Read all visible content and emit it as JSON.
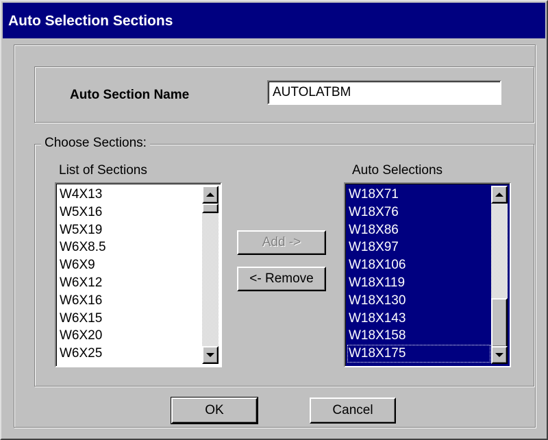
{
  "window": {
    "title": "Auto Selection Sections"
  },
  "name_field": {
    "label": "Auto Section Name",
    "value": "AUTOLATBM"
  },
  "choose_group": {
    "legend": "Choose Sections:"
  },
  "list_of_sections": {
    "label": "List of Sections",
    "items": [
      "W4X13",
      "W5X16",
      "W5X19",
      "W6X8.5",
      "W6X9",
      "W6X12",
      "W6X16",
      "W6X15",
      "W6X20",
      "W6X25"
    ]
  },
  "auto_selections": {
    "label": "Auto Selections",
    "items": [
      "W18X71",
      "W18X76",
      "W18X86",
      "W18X97",
      "W18X106",
      "W18X119",
      "W18X130",
      "W18X143",
      "W18X158",
      "W18X175"
    ],
    "selection_color": "#000080"
  },
  "buttons": {
    "add": "Add ->",
    "remove": "<- Remove",
    "ok": "OK",
    "cancel": "Cancel"
  },
  "colors": {
    "titlebar": "#000080",
    "face": "#c0c0c0"
  }
}
